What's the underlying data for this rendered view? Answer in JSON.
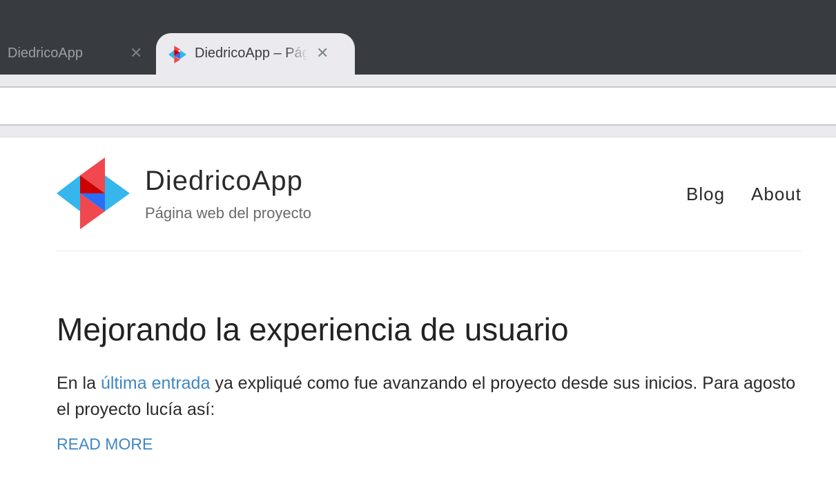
{
  "browser": {
    "tabs": [
      {
        "title": "DiedricoApp",
        "close": "✕"
      },
      {
        "title": "DiedricoApp – Página web del proyecto",
        "close": "✕"
      }
    ]
  },
  "site": {
    "title": "DiedricoApp",
    "tagline": "Página web del proyecto",
    "nav": [
      "Blog",
      "About"
    ],
    "colors": {
      "red": "#f0484e",
      "dark_red": "#c00",
      "blue": "#2b6ef5",
      "light_blue": "#35b6ec"
    }
  },
  "post": {
    "title": "Mejorando la experiencia de usuario",
    "excerpt_before": "En la ",
    "excerpt_link": "última entrada",
    "excerpt_after": " ya expliqué como fue avanzando el proyecto desde sus inicios. Para agosto el proyecto lucía así:",
    "read_more": "READ MORE"
  }
}
